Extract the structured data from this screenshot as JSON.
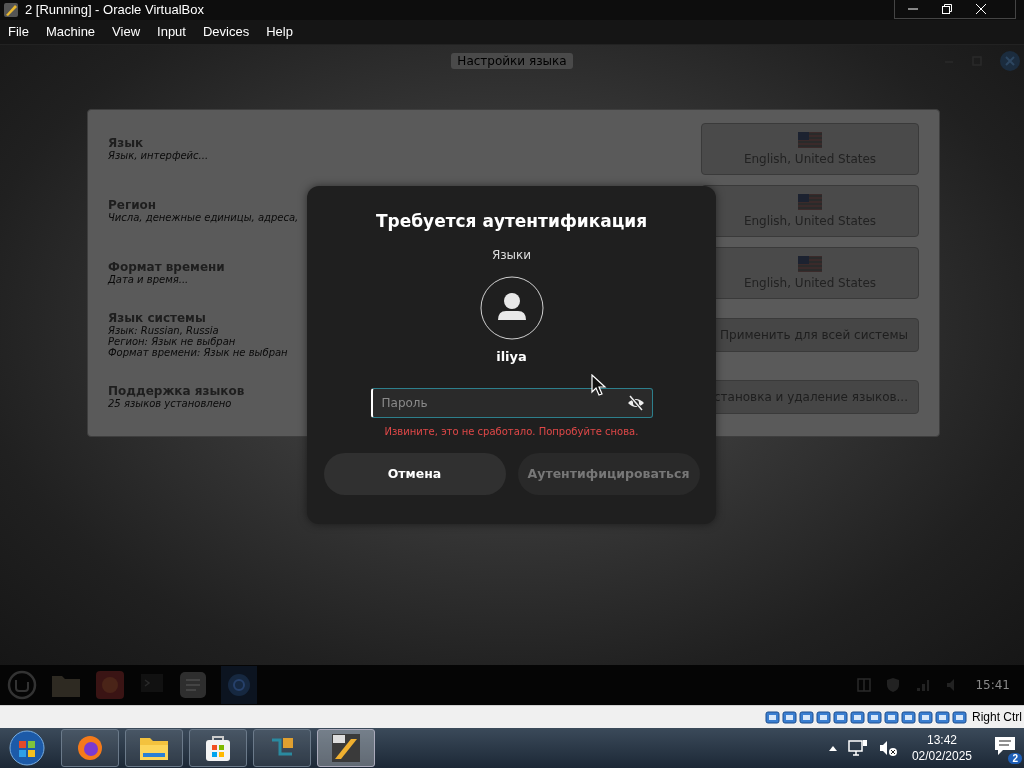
{
  "window": {
    "title": "2 [Running] - Oracle VirtualBox"
  },
  "menu": [
    "File",
    "Machine",
    "View",
    "Input",
    "Devices",
    "Help"
  ],
  "guest": {
    "title": "Настройки языка",
    "settings": [
      {
        "title": "Язык",
        "details": [
          "Язык, интерфейс..."
        ],
        "control": {
          "kind": "locale",
          "label": "English, United States"
        }
      },
      {
        "title": "Регион",
        "details": [
          "Числа, денежные единицы, адреса,"
        ],
        "control": {
          "kind": "locale",
          "label": "English, United States"
        }
      },
      {
        "title": "Формат времени",
        "details": [
          "Дата и время..."
        ],
        "control": {
          "kind": "locale",
          "label": "English, United States"
        }
      },
      {
        "title": "Язык системы",
        "details": [
          "Язык: Russian, Russia",
          "Регион: Язык не выбран",
          "Формат времени: Язык не выбран"
        ],
        "control": {
          "kind": "button",
          "label": "Применить для всей системы"
        }
      },
      {
        "title": "Поддержка языков",
        "details": [
          "25 языков установлено"
        ],
        "control": {
          "kind": "button",
          "label": "становка и удаление языков..."
        }
      }
    ],
    "dialog": {
      "title": "Требуется аутентификация",
      "subtitle": "Языки",
      "user": "iliya",
      "password": {
        "placeholder": "Пароль",
        "focused": true
      },
      "error": "Извините, это не сработало. Попробуйте снова.",
      "buttons": [
        {
          "label": "Отмена",
          "disabled": false
        },
        {
          "label": "Аутентифицироваться",
          "disabled": true
        }
      ]
    },
    "panel": {
      "clock": "15:41"
    }
  },
  "status_bar": {
    "host_key": "Right Ctrl"
  },
  "taskbar": {
    "apps": [
      {
        "kind": "firefox",
        "selected": false
      },
      {
        "kind": "folder",
        "selected": false
      },
      {
        "kind": "store",
        "selected": false
      },
      {
        "kind": "vbox",
        "selected": false
      },
      {
        "kind": "vbox64",
        "selected": true
      }
    ],
    "time": "13:42",
    "date": "02/02/2025",
    "notifications": "2"
  }
}
